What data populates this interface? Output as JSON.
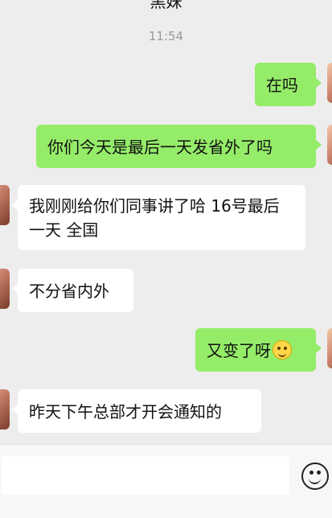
{
  "header": {
    "title": "黑妹"
  },
  "chat": {
    "timestamp": "11:54",
    "messages": [
      {
        "direction": "out",
        "text": "在吗"
      },
      {
        "direction": "out",
        "text": "你们今天是最后一天发省外了吗"
      },
      {
        "direction": "in",
        "text": "我刚刚给你们同事讲了哈 16号最后一天 全国"
      },
      {
        "direction": "in",
        "text": "不分省内外"
      },
      {
        "direction": "out",
        "text": "又变了呀",
        "emoji": "grinning-face-icon"
      },
      {
        "direction": "in",
        "text": "昨天下午总部才开会通知的"
      }
    ]
  },
  "input": {
    "value": "",
    "emoji_button_icon": "smiley-icon"
  },
  "colors": {
    "out_bubble": "#95ec69",
    "in_bubble": "#ffffff",
    "background": "#ededed"
  }
}
